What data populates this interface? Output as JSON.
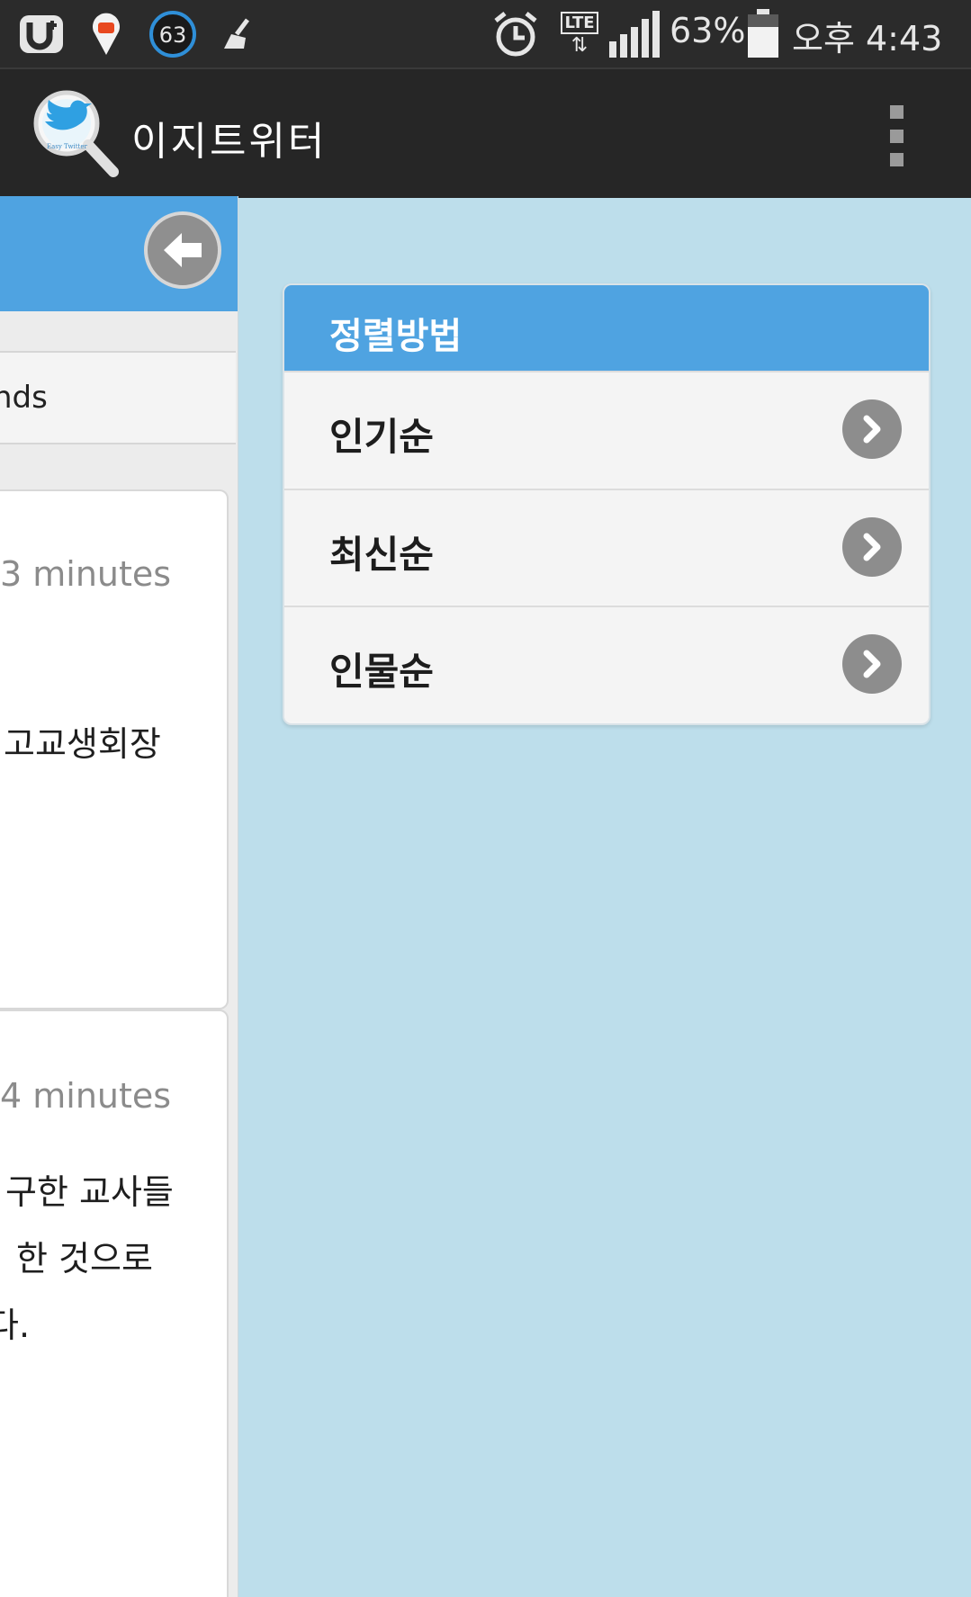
{
  "status_bar": {
    "notification_badge": "63",
    "network_type": "LTE",
    "battery_percent": "63%",
    "time": "오후 4:43",
    "icons": [
      "u-plus-icon",
      "location-pin-icon",
      "badge-63-icon",
      "cleaner-icon",
      "alarm-icon",
      "lte-icon",
      "signal-icon",
      "battery-icon"
    ]
  },
  "app_bar": {
    "title": "이지트위터",
    "logo_caption": "Easy Twitter"
  },
  "left_panel": {
    "tab_label": "nds",
    "tweets": [
      {
        "time": "3 minutes",
        "lines": [
          "고교생회장"
        ]
      },
      {
        "time": "4 minutes",
        "lines": [
          "구한 교사들",
          "한 것으로",
          "다."
        ]
      }
    ]
  },
  "sort_menu": {
    "title": "정렬방법",
    "items": [
      {
        "label": "인기순"
      },
      {
        "label": "최신순"
      },
      {
        "label": "인물순"
      }
    ]
  },
  "colors": {
    "accent_blue": "#4fa3e1",
    "background": "#bddeeb",
    "appbar": "#262626",
    "statusbar": "#2b2b2b"
  }
}
